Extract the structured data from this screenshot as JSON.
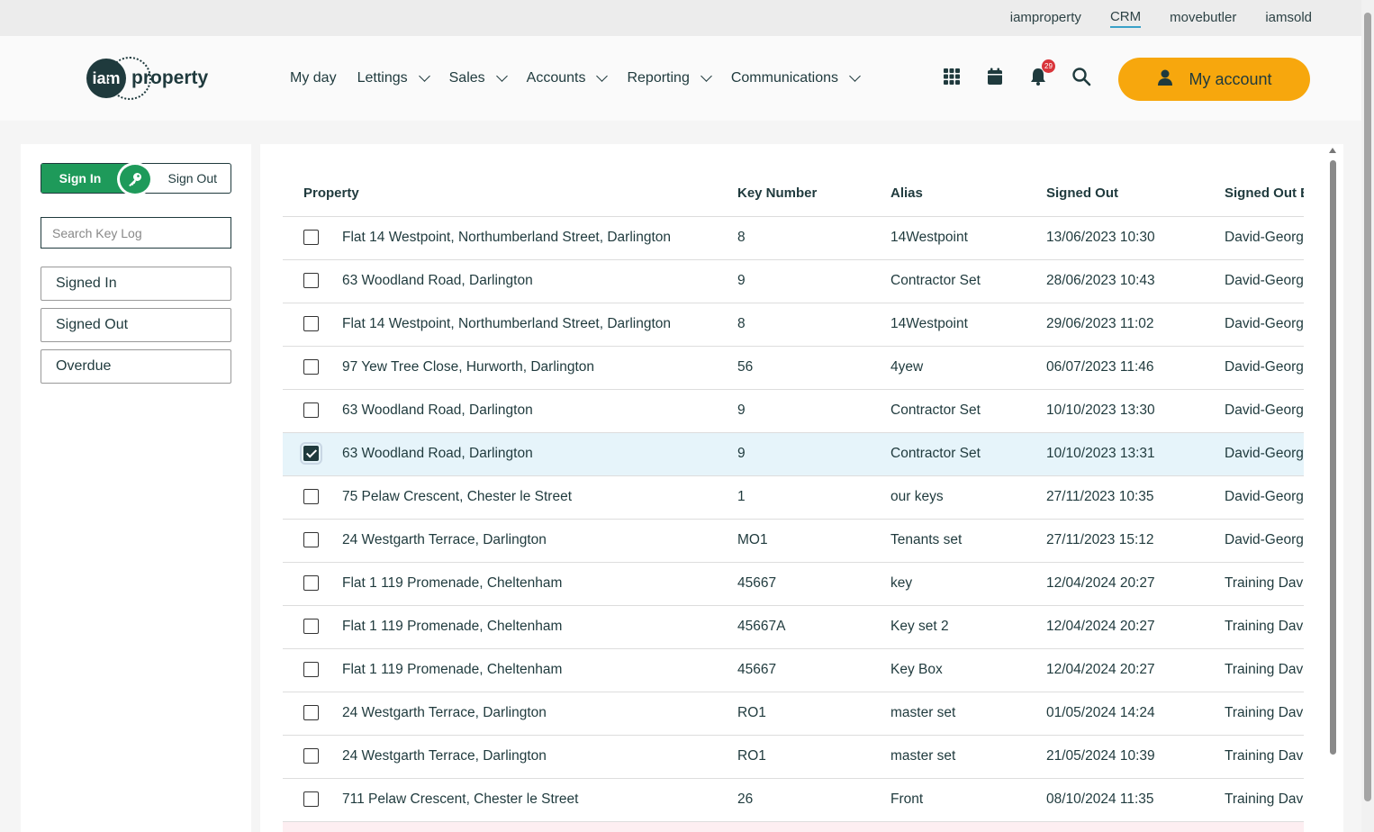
{
  "topbar": {
    "links": [
      "iamproperty",
      "CRM",
      "movebutler",
      "iamsold"
    ]
  },
  "logo": {
    "mark": "iam",
    "word": "property"
  },
  "nav": {
    "items": [
      "My day",
      "Lettings",
      "Sales",
      "Accounts",
      "Reporting",
      "Communications"
    ]
  },
  "header": {
    "notification_count": "29",
    "account_label": "My account"
  },
  "left_panel": {
    "sign_in_label": "Sign In",
    "sign_out_label": "Sign Out",
    "search_placeholder": "Search Key Log",
    "filters": [
      "Signed In",
      "Signed Out",
      "Overdue"
    ]
  },
  "table": {
    "columns": [
      "Property",
      "Key Number",
      "Alias",
      "Signed Out",
      "Signed Out By"
    ],
    "rows": [
      {
        "property": "Flat 14 Westpoint, Northumberland Street, Darlington",
        "key": "8",
        "alias": "14Westpoint",
        "signed_out": "13/06/2023 10:30",
        "by": "David-George",
        "checked": false
      },
      {
        "property": "63 Woodland Road, Darlington",
        "key": "9",
        "alias": "Contractor Set",
        "signed_out": "28/06/2023 10:43",
        "by": "David-George",
        "checked": false
      },
      {
        "property": "Flat 14 Westpoint, Northumberland Street, Darlington",
        "key": "8",
        "alias": "14Westpoint",
        "signed_out": "29/06/2023 11:02",
        "by": "David-George",
        "checked": false
      },
      {
        "property": "97 Yew Tree Close, Hurworth, Darlington",
        "key": "56",
        "alias": "4yew",
        "signed_out": "06/07/2023 11:46",
        "by": "David-George",
        "checked": false
      },
      {
        "property": "63 Woodland Road, Darlington",
        "key": "9",
        "alias": "Contractor Set",
        "signed_out": "10/10/2023 13:30",
        "by": "David-George",
        "checked": false
      },
      {
        "property": "63 Woodland Road, Darlington",
        "key": "9",
        "alias": "Contractor Set",
        "signed_out": "10/10/2023 13:31",
        "by": "David-George",
        "checked": true
      },
      {
        "property": "75 Pelaw Crescent, Chester le Street",
        "key": "1",
        "alias": "our keys",
        "signed_out": "27/11/2023 10:35",
        "by": "David-George",
        "checked": false
      },
      {
        "property": "24 Westgarth Terrace, Darlington",
        "key": "MO1",
        "alias": "Tenants set",
        "signed_out": "27/11/2023 15:12",
        "by": "David-George",
        "checked": false
      },
      {
        "property": "Flat 1 119 Promenade, Cheltenham",
        "key": "45667",
        "alias": "key",
        "signed_out": "12/04/2024 20:27",
        "by": "Training Dave",
        "checked": false
      },
      {
        "property": "Flat 1 119 Promenade, Cheltenham",
        "key": "45667A",
        "alias": "Key set 2",
        "signed_out": "12/04/2024 20:27",
        "by": "Training Dave",
        "checked": false
      },
      {
        "property": "Flat 1 119 Promenade, Cheltenham",
        "key": "45667",
        "alias": "Key Box",
        "signed_out": "12/04/2024 20:27",
        "by": "Training Dave",
        "checked": false
      },
      {
        "property": "24 Westgarth Terrace, Darlington",
        "key": "RO1",
        "alias": "master set",
        "signed_out": "01/05/2024 14:24",
        "by": "Training Dave",
        "checked": false
      },
      {
        "property": "24 Westgarth Terrace, Darlington",
        "key": "RO1",
        "alias": "master set",
        "signed_out": "21/05/2024 10:39",
        "by": "Training Dave",
        "checked": false
      },
      {
        "property": "711 Pelaw Crescent, Chester le Street",
        "key": "26",
        "alias": "Front",
        "signed_out": "08/10/2024 11:35",
        "by": "Training Dave",
        "checked": false
      }
    ]
  },
  "colors": {
    "accent": "#f7a70d",
    "green": "#1e9a5a",
    "text": "#1f3a3d",
    "selected_row": "#e6f4fa"
  },
  "icons": [
    "apps-grid-icon",
    "calendar-icon",
    "bell-icon",
    "search-icon",
    "user-icon",
    "key-icon"
  ]
}
